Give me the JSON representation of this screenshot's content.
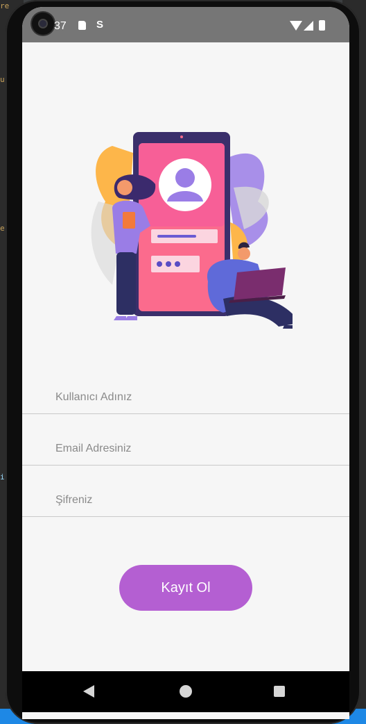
{
  "status_bar": {
    "time": "37",
    "icons": [
      "sd-card-icon",
      "s-icon",
      "wifi-icon",
      "signal-icon",
      "battery-icon"
    ],
    "s_glyph": "S"
  },
  "illustration": {
    "subject": "login-illustration-icon"
  },
  "form": {
    "username_placeholder": "Kullanıcı Adınız",
    "email_placeholder": "Email Adresiniz",
    "password_placeholder": "Şifreniz",
    "submit_label": "Kayıt Ol"
  },
  "nav_bar": {
    "icons": [
      "back-icon",
      "home-icon",
      "recents-icon"
    ]
  },
  "colors": {
    "accent": "#b45fd2",
    "status_bar": "#767676",
    "screen_background": "#f6f6f6",
    "divider": "#c9c9c9"
  }
}
